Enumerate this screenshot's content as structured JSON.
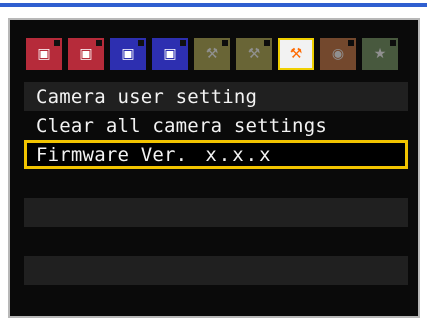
{
  "accent_color": "#2f5fd0",
  "tabs": [
    {
      "icon": "shooting-menu-1-icon",
      "glyph": "▣",
      "color": "#b62b3a",
      "state": "normal"
    },
    {
      "icon": "shooting-menu-2-icon",
      "glyph": "▣",
      "color": "#b62b3a",
      "state": "normal"
    },
    {
      "icon": "playback-menu-1-icon",
      "glyph": "▣",
      "color": "#2d2fb0",
      "state": "normal"
    },
    {
      "icon": "playback-menu-2-icon",
      "glyph": "▣",
      "color": "#2d2fb0",
      "state": "normal"
    },
    {
      "icon": "setup-menu-1-icon",
      "glyph": "⚒",
      "color": "#b7b15a",
      "state": "dim"
    },
    {
      "icon": "setup-menu-2-icon",
      "glyph": "⚒",
      "color": "#b7b15a",
      "state": "dim"
    },
    {
      "icon": "setup-menu-3-icon",
      "glyph": "⚒",
      "color": "#f2f2f2",
      "state": "active"
    },
    {
      "icon": "custom-functions-icon",
      "glyph": "◉",
      "color": "#c97c4b",
      "state": "dim"
    },
    {
      "icon": "my-menu-icon",
      "glyph": "★",
      "color": "#7c9a6a",
      "state": "dim"
    }
  ],
  "menu": {
    "items": [
      {
        "label": "Camera user setting"
      },
      {
        "label": "Clear all camera settings"
      },
      {
        "label": "Firmware Ver.",
        "value": "x.x.x"
      }
    ]
  }
}
